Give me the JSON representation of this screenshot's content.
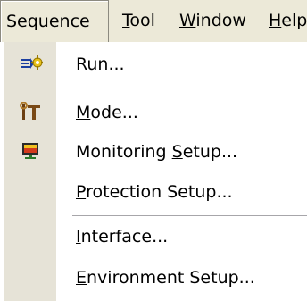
{
  "menubar": {
    "items": [
      {
        "pre": "Seque",
        "u": "",
        "post": "nce"
      },
      {
        "pre": "",
        "u": "T",
        "post": "ool"
      },
      {
        "pre": "",
        "u": "W",
        "post": "indow"
      },
      {
        "pre": "",
        "u": "H",
        "post": "elp"
      }
    ]
  },
  "menu": {
    "items": [
      {
        "pre": "",
        "u": "R",
        "post": "un...",
        "icon": "run-icon"
      },
      {
        "pre": "",
        "u": "M",
        "post": "ode...",
        "icon": "mode-tools-icon"
      },
      {
        "pre": "Monitoring ",
        "u": "S",
        "post": "etup...",
        "icon": "monitor-icon"
      },
      {
        "pre": "",
        "u": "P",
        "post": "rotection Setup...",
        "icon": ""
      },
      {
        "pre": "",
        "u": "I",
        "post": "nterface...",
        "icon": ""
      },
      {
        "pre": "",
        "u": "E",
        "post": "nvironment Setup...",
        "icon": ""
      }
    ]
  },
  "colors": {
    "menubar_bg": "#ece9d8",
    "gutter_bg": "#e6e3d7",
    "separator": "#a7a6aa"
  }
}
